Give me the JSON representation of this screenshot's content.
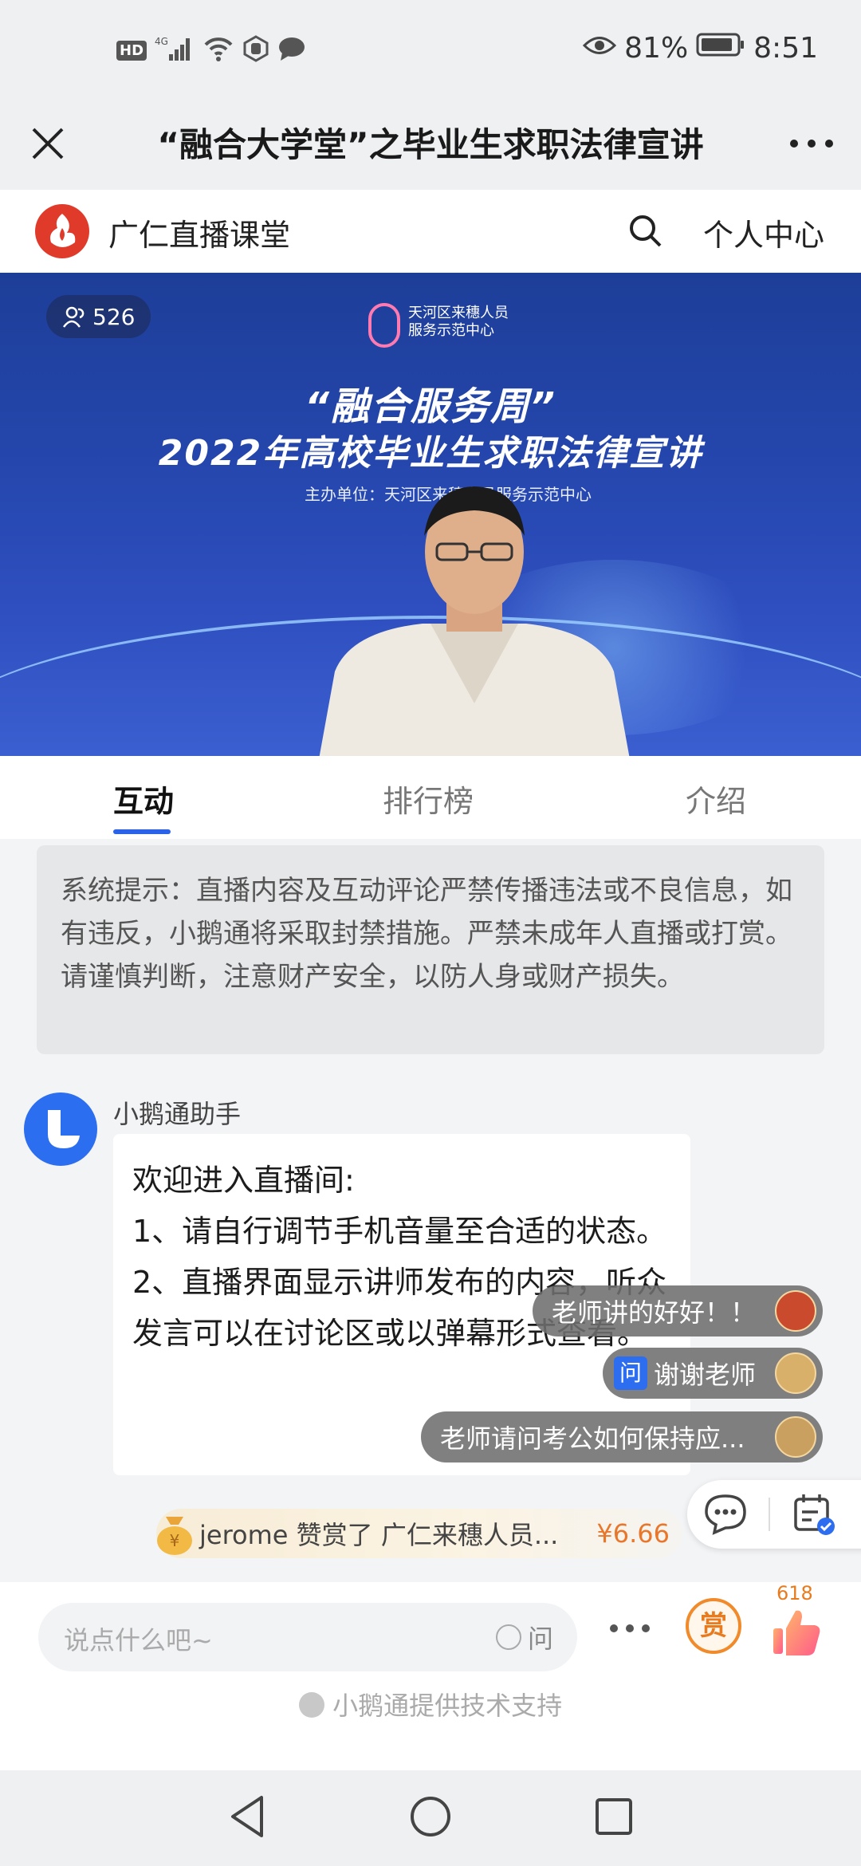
{
  "status_bar": {
    "network_label": "HD",
    "signal_label": "4G",
    "battery_percent": "81%",
    "time": "8:51"
  },
  "title_bar": {
    "title": "“融合大学堂”之毕业生求职法律宣讲"
  },
  "header": {
    "brand": "广仁直播课堂",
    "profile_link": "个人中心"
  },
  "video": {
    "viewer_count": "526",
    "org_name_line1": "天河区来穗人员",
    "org_name_line2": "服务示范中心",
    "banner_line1": "“融合服务周”",
    "banner_line2": "2022年高校毕业生求职法律宣讲",
    "host_line": "主办单位：天河区来穗人员服务示范中心"
  },
  "tabs": [
    {
      "label": "互动",
      "active": true
    },
    {
      "label": "排行榜",
      "active": false
    },
    {
      "label": "介绍",
      "active": false
    }
  ],
  "notice": {
    "text": "系统提示：直播内容及互动评论严禁传播违法或不良信息，如有违反，小鹅通将采取封禁措施。严禁未成年人直播或打赏。请谨慎判断，注意财产安全，以防人身或财产损失。"
  },
  "assistant_message": {
    "name": "小鹅通助手",
    "line1": "欢迎进入直播间:",
    "line2": "1、请自行调节手机音量至合适的状态。",
    "line3": "2、直播界面显示讲师发布的内容，听众发言可以在讨论区或以弹幕形式查看。"
  },
  "danmaku": [
    {
      "text": "老师讲的好好！！",
      "badge": ""
    },
    {
      "text": "谢谢老师",
      "badge": "问"
    },
    {
      "text": "老师请问考公如何保持应...",
      "badge": ""
    }
  ],
  "reward": {
    "text": "jerome 赞赏了 广仁来穗人员...",
    "amount": "¥6.66"
  },
  "input": {
    "placeholder": "说点什么吧~",
    "ask_label": "问"
  },
  "actions": {
    "reward_label": "赏",
    "like_count": "618"
  },
  "footer": {
    "support_text": "小鹅通提供技术支持"
  },
  "colors": {
    "accent_blue": "#2a62e8",
    "reward_orange": "#e87b1e",
    "brand_red": "#e03a2a"
  }
}
